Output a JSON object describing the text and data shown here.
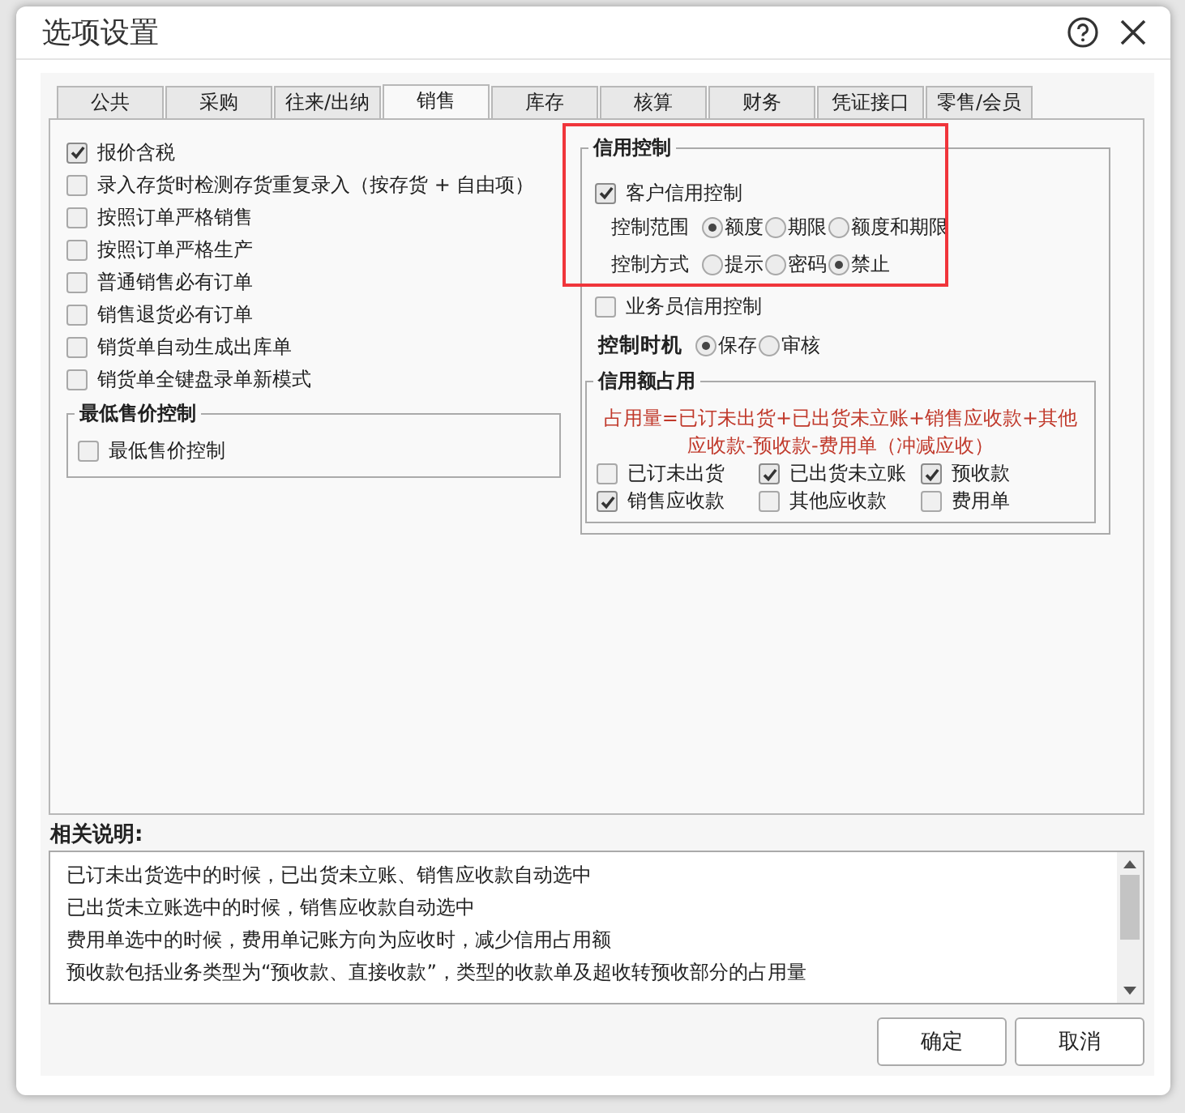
{
  "window": {
    "title": "选项设置"
  },
  "tabs": [
    {
      "label": "公共",
      "selected": false
    },
    {
      "label": "采购",
      "selected": false
    },
    {
      "label": "往来/出纳",
      "selected": false
    },
    {
      "label": "销售",
      "selected": true
    },
    {
      "label": "库存",
      "selected": false
    },
    {
      "label": "核算",
      "selected": false
    },
    {
      "label": "财务",
      "selected": false
    },
    {
      "label": "凭证接口",
      "selected": false
    },
    {
      "label": "零售/会员",
      "selected": false
    }
  ],
  "options": [
    {
      "label": "报价含税",
      "checked": true
    },
    {
      "label": "录入存货时检测存货重复录入（按存货 + 自由项）",
      "checked": false
    },
    {
      "label": "按照订单严格销售",
      "checked": false
    },
    {
      "label": "按照订单严格生产",
      "checked": false
    },
    {
      "label": "普通销售必有订单",
      "checked": false
    },
    {
      "label": "销售退货必有订单",
      "checked": false
    },
    {
      "label": "销货单自动生成出库单",
      "checked": false
    },
    {
      "label": "销货单全键盘录单新模式",
      "checked": false
    }
  ],
  "min_price": {
    "title": "最低售价控制",
    "options": [
      {
        "label": "最低售价控制",
        "checked": false
      }
    ]
  },
  "credit": {
    "title": "信用控制",
    "customer_credit": {
      "label": "客户信用控制",
      "checked": true
    },
    "scope": {
      "label": "控制范围",
      "options": [
        {
          "label": "额度",
          "selected": true
        },
        {
          "label": "期限",
          "selected": false
        },
        {
          "label": "额度和期限",
          "selected": false
        }
      ]
    },
    "method": {
      "label": "控制方式",
      "options": [
        {
          "label": "提示",
          "selected": false
        },
        {
          "label": "密码",
          "selected": false
        },
        {
          "label": "禁止",
          "selected": true
        }
      ]
    },
    "salesman_credit": {
      "label": "业务员信用控制",
      "checked": false
    },
    "timing": {
      "label": "控制时机",
      "options": [
        {
          "label": "保存",
          "selected": true
        },
        {
          "label": "审核",
          "selected": false
        }
      ]
    },
    "occupancy": {
      "title": "信用额占用",
      "formula": "占用量=已订未出货+已出货未立账+销售应收款+其他应收款-预收款-费用单（冲减应收）",
      "items": [
        {
          "label": "已订未出货",
          "checked": false
        },
        {
          "label": "已出货未立账",
          "checked": true
        },
        {
          "label": "预收款",
          "checked": true
        },
        {
          "label": "销售应收款",
          "checked": true
        },
        {
          "label": "其他应收款",
          "checked": false
        },
        {
          "label": "费用单",
          "checked": false
        }
      ]
    }
  },
  "description": {
    "title": "相关说明:",
    "lines": [
      "已订未出货选中的时候，已出货未立账、销售应收款自动选中",
      "已出货未立账选中的时候，销售应收款自动选中",
      "费用单选中的时候，费用单记账方向为应收时，减少信用占用额",
      "预收款包括业务类型为“预收款、直接收款”，类型的收款单及超收转预收部分的占用量"
    ]
  },
  "buttons": [
    {
      "label": "确定"
    },
    {
      "label": "取消"
    }
  ]
}
